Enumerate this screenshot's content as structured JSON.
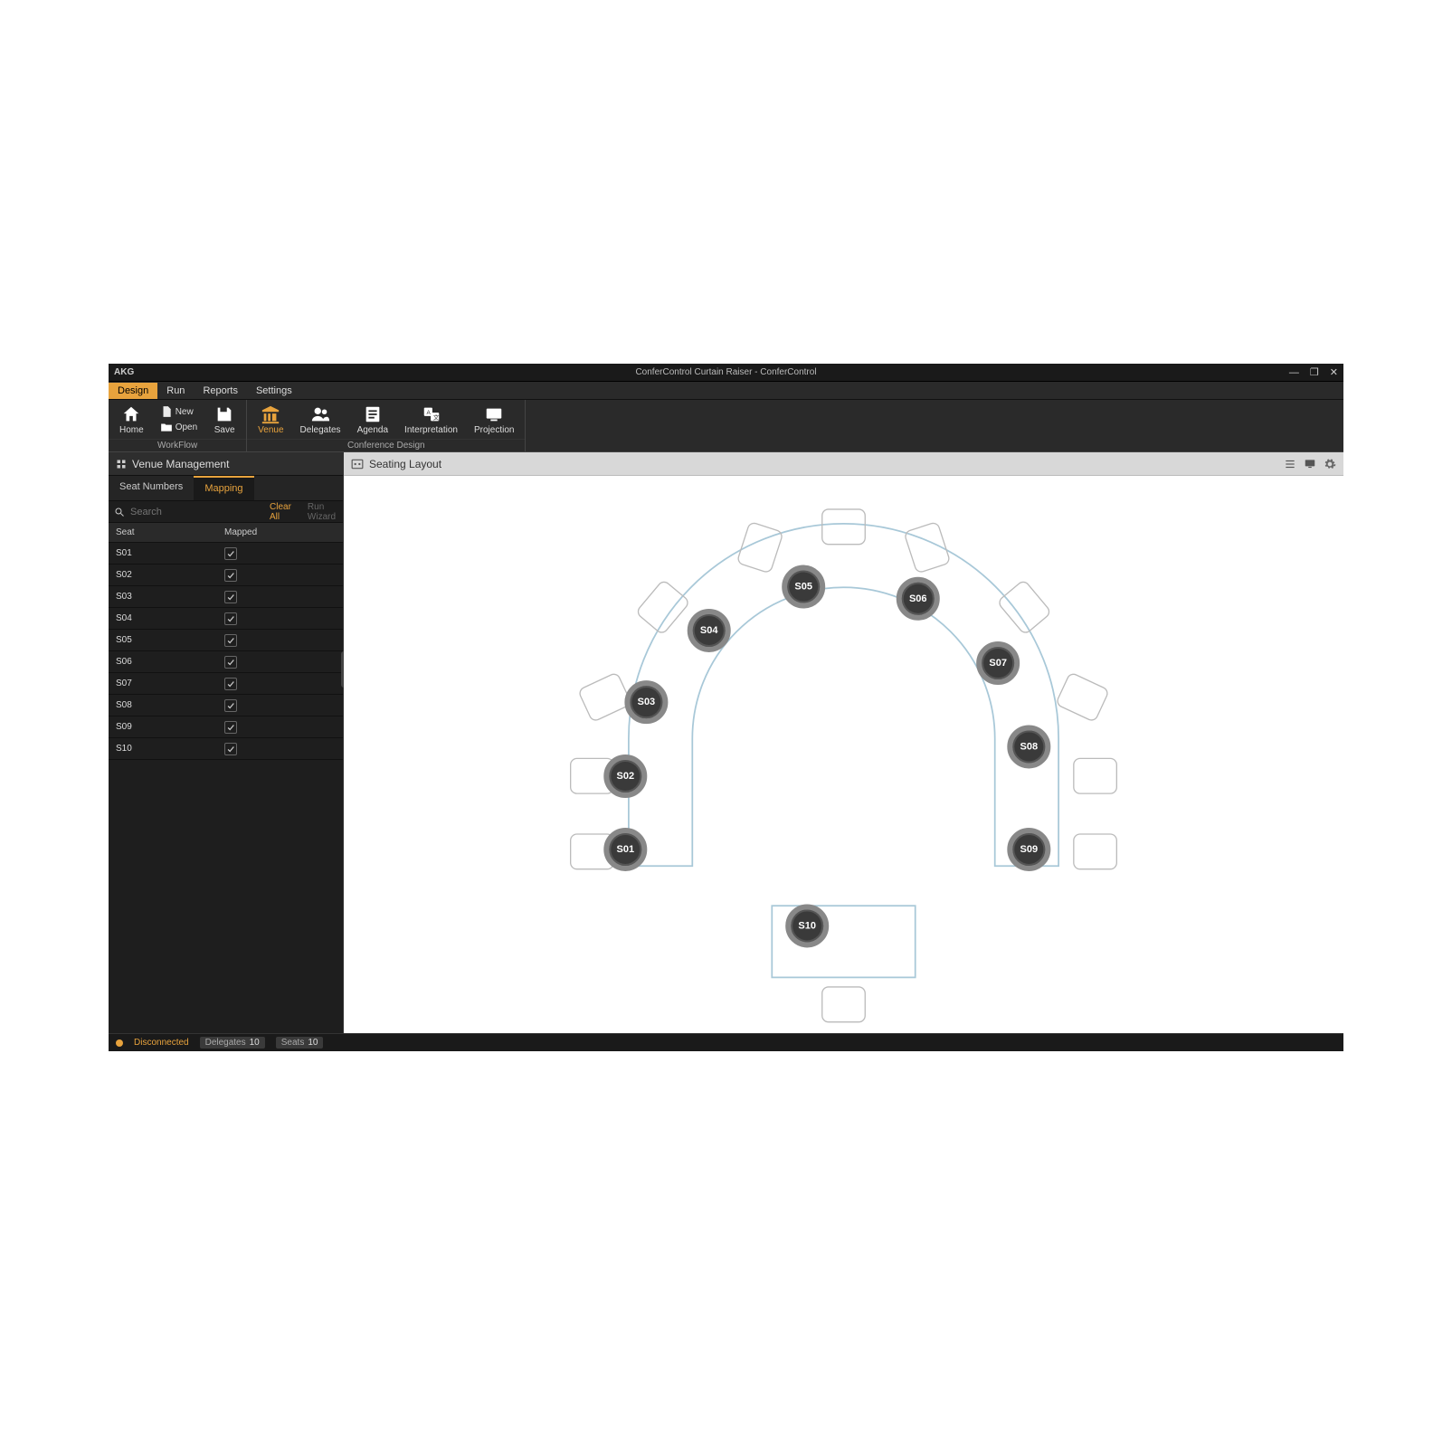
{
  "brand": "AKG",
  "window_title": "ConferControl Curtain Raiser - ConferControl",
  "menu": {
    "items": [
      "Design",
      "Run",
      "Reports",
      "Settings"
    ],
    "active": "Design"
  },
  "ribbon": {
    "workflow_caption": "WorkFlow",
    "conference_caption": "Conference Design",
    "home": "Home",
    "new": "New",
    "open": "Open",
    "save": "Save",
    "venue": "Venue",
    "delegates": "Delegates",
    "agenda": "Agenda",
    "interpretation": "Interpretation",
    "projection": "Projection"
  },
  "sidebar": {
    "title": "Venue Management",
    "tabs": {
      "seat_numbers": "Seat Numbers",
      "mapping": "Mapping"
    },
    "search_placeholder": "Search",
    "clear_all": "Clear All",
    "run_wizard": "Run Wizard",
    "header_seat": "Seat",
    "header_mapped": "Mapped",
    "rows": [
      {
        "seat": "S01",
        "mapped": true
      },
      {
        "seat": "S02",
        "mapped": true
      },
      {
        "seat": "S03",
        "mapped": true
      },
      {
        "seat": "S04",
        "mapped": true
      },
      {
        "seat": "S05",
        "mapped": true
      },
      {
        "seat": "S06",
        "mapped": true
      },
      {
        "seat": "S07",
        "mapped": true
      },
      {
        "seat": "S08",
        "mapped": true
      },
      {
        "seat": "S09",
        "mapped": true
      },
      {
        "seat": "S10",
        "mapped": true
      }
    ]
  },
  "main": {
    "title": "Seating Layout",
    "seats": [
      "S01",
      "S02",
      "S03",
      "S04",
      "S05",
      "S06",
      "S07",
      "S08",
      "S09",
      "S10"
    ]
  },
  "status": {
    "connection": "Disconnected",
    "delegates_label": "Delegates",
    "delegates_value": "10",
    "seats_label": "Seats",
    "seats_value": "10"
  },
  "colors": {
    "accent": "#e8a33d",
    "table": "#a8c8d8"
  }
}
